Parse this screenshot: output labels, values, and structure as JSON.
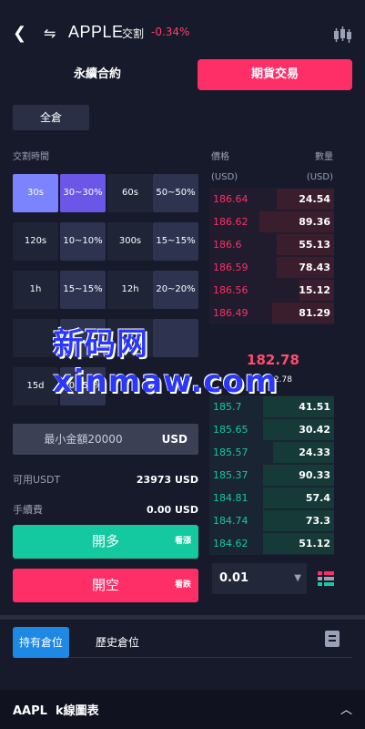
{
  "header": {
    "symbol": "APPLE",
    "delivery_type": "交割",
    "change_pct": "-0.34%",
    "icons": {
      "back": "chevron-left-icon",
      "swap": "swap-arrows-icon",
      "chart": "candlestick-icon"
    }
  },
  "tabs": [
    {
      "label": "永續合約",
      "active": false
    },
    {
      "label": "期貨交易",
      "active": true
    }
  ],
  "position_mode": "全倉",
  "delivery_time_label": "交割時間",
  "time_options": [
    {
      "time": "30s",
      "range": "30~30%"
    },
    {
      "time": "60s",
      "range": "50~50%"
    },
    {
      "time": "120s",
      "range": "10~10%"
    },
    {
      "time": "300s",
      "range": "15~15%"
    },
    {
      "time": "1h",
      "range": "15~15%"
    },
    {
      "time": "12h",
      "range": "20~20%"
    },
    {
      "time": "",
      "range": ""
    },
    {
      "time": "",
      "range": ""
    },
    {
      "time": "15d",
      "range": "50~50%"
    }
  ],
  "amount": {
    "placeholder": "最小金額20000",
    "currency": "USD"
  },
  "available": {
    "label": "可用USDT",
    "value": "23973 USD"
  },
  "fee": {
    "label": "手續費",
    "value": "0.00 USD"
  },
  "buttons": {
    "long": {
      "label": "開多",
      "hint": "看漲"
    },
    "short": {
      "label": "開空",
      "hint": "看跌"
    }
  },
  "orderbook": {
    "price_label": "價格",
    "qty_label": "數量",
    "price_unit": "(USD)",
    "qty_unit": "(USD)",
    "asks": [
      {
        "price": "186.64",
        "qty": "24.54",
        "depth": 0.46
      },
      {
        "price": "186.62",
        "qty": "89.36",
        "depth": 0.6
      },
      {
        "price": "186.6",
        "qty": "55.13",
        "depth": 0.46
      },
      {
        "price": "186.59",
        "qty": "78.43",
        "depth": 0.46
      },
      {
        "price": "186.56",
        "qty": "15.12",
        "depth": 0.28
      },
      {
        "price": "186.49",
        "qty": "81.29",
        "depth": 0.5
      }
    ],
    "last_price": "182.78",
    "ref_price": "≈ 182.78",
    "bids": [
      {
        "price": "185.7",
        "qty": "41.51",
        "depth": 0.57
      },
      {
        "price": "185.65",
        "qty": "30.42",
        "depth": 0.57
      },
      {
        "price": "185.57",
        "qty": "24.33",
        "depth": 0.49
      },
      {
        "price": "185.37",
        "qty": "90.33",
        "depth": 0.57
      },
      {
        "price": "184.81",
        "qty": "57.4",
        "depth": 0.57
      },
      {
        "price": "184.74",
        "qty": "73.3",
        "depth": 0.57
      },
      {
        "price": "184.62",
        "qty": "51.12",
        "depth": 0.57
      }
    ],
    "depth_value": "0.01"
  },
  "holding_tabs": [
    {
      "label": "持有倉位",
      "active": true
    },
    {
      "label": "歷史倉位",
      "active": false
    }
  ],
  "footer": {
    "title": "AAPL  k線圖表"
  },
  "watermark": "新码网xinmaw.com",
  "colors": {
    "up": "#14c9a0",
    "down": "#fe2f67",
    "accent_blue": "#1e88e5",
    "selected_time": "#7b83ff"
  }
}
